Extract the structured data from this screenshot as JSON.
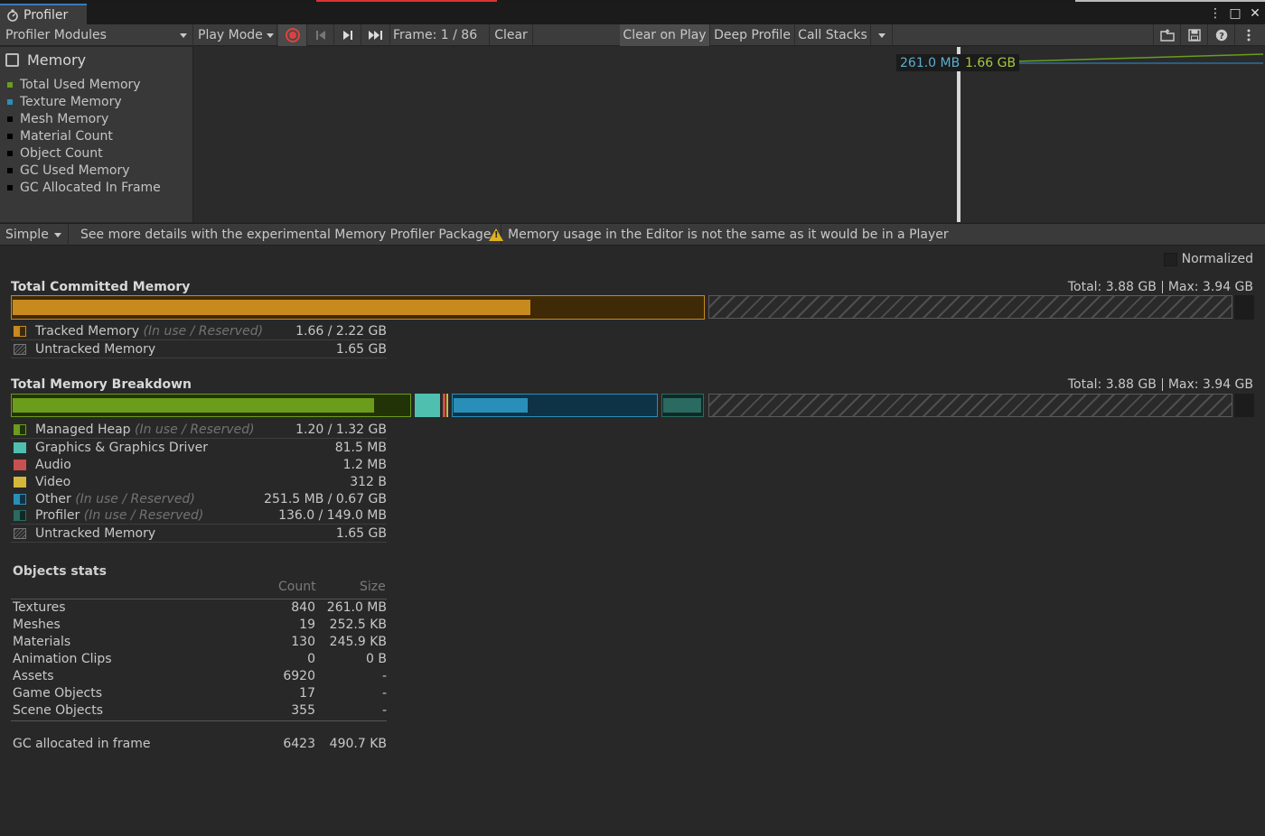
{
  "window": {
    "tab_title": "Profiler",
    "controls": [
      "⋮",
      "□",
      "✕"
    ]
  },
  "toolbar": {
    "modules_dropdown": "Profiler Modules",
    "play_mode": "Play Mode",
    "frame": "Frame: 1 / 86",
    "clear": "Clear",
    "clear_on_play": "Clear on Play",
    "deep_profile": "Deep Profile",
    "call_stacks": "Call Stacks"
  },
  "module": {
    "title": "Memory",
    "legend": [
      {
        "label": "Total Used Memory",
        "color": "#6c9c1c"
      },
      {
        "label": "Texture Memory",
        "color": "#2a8fb8"
      },
      {
        "label": "Mesh Memory",
        "color": "#000000"
      },
      {
        "label": "Material Count",
        "color": "#000000"
      },
      {
        "label": "Object Count",
        "color": "#000000"
      },
      {
        "label": "GC Used Memory",
        "color": "#000000"
      },
      {
        "label": "GC Allocated In Frame",
        "color": "#000000"
      }
    ]
  },
  "chart_labels": {
    "texture_value": "261.0 MB",
    "total_value": "1.66 GB"
  },
  "bar2": {
    "mode": "Simple",
    "info": "See more details with the experimental Memory Profiler Package.",
    "warning": "Memory usage in the Editor is not the same as it would be in a Player"
  },
  "detail": {
    "normalized_label": "Normalized",
    "committed": {
      "title": "Total Committed Memory",
      "total": "Total: 3.88 GB",
      "max": "Max: 3.94 GB",
      "tracked_fill_fraction": 0.75,
      "rows": [
        {
          "name": "Tracked Memory",
          "note": "(In use / Reserved)",
          "value": "1.66 / 2.22 GB",
          "color": "#c88a1e"
        },
        {
          "name": "Untracked Memory",
          "note": "",
          "value": "1.65 GB",
          "color": "#3a3a3a"
        }
      ]
    },
    "breakdown": {
      "title": "Total Memory Breakdown",
      "total": "Total: 3.88 GB",
      "max": "Max: 3.94 GB",
      "rows": [
        {
          "name": "Managed Heap",
          "note": "(In use / Reserved)",
          "value": "1.20 / 1.32 GB",
          "color": "#6c9c1c"
        },
        {
          "name": "Graphics & Graphics Driver",
          "note": "",
          "value": "81.5 MB",
          "color": "#4fc0b0"
        },
        {
          "name": "Audio",
          "note": "",
          "value": "1.2 MB",
          "color": "#c85050"
        },
        {
          "name": "Video",
          "note": "",
          "value": "312 B",
          "color": "#d4b83a"
        },
        {
          "name": "Other",
          "note": "(In use / Reserved)",
          "value": "251.5 MB / 0.67 GB",
          "color": "#2a8fb8"
        },
        {
          "name": "Profiler",
          "note": "(In use / Reserved)",
          "value": "136.0 / 149.0 MB",
          "color": "#2a6a60"
        },
        {
          "name": "Untracked Memory",
          "note": "",
          "value": "1.65 GB",
          "color": "#3a3a3a"
        }
      ]
    },
    "objects": {
      "title": "Objects stats",
      "col_count": "Count",
      "col_size": "Size",
      "rows": [
        {
          "name": "Textures",
          "count": "840",
          "size": "261.0 MB"
        },
        {
          "name": "Meshes",
          "count": "19",
          "size": "252.5 KB"
        },
        {
          "name": "Materials",
          "count": "130",
          "size": "245.9 KB"
        },
        {
          "name": "Animation Clips",
          "count": "0",
          "size": "0 B"
        },
        {
          "name": "Assets",
          "count": "6920",
          "size": "-"
        },
        {
          "name": "Game Objects",
          "count": "17",
          "size": "-"
        },
        {
          "name": "Scene Objects",
          "count": "355",
          "size": "-"
        }
      ],
      "gc": {
        "name": "GC allocated in frame",
        "count": "6423",
        "size": "490.7 KB"
      }
    }
  }
}
